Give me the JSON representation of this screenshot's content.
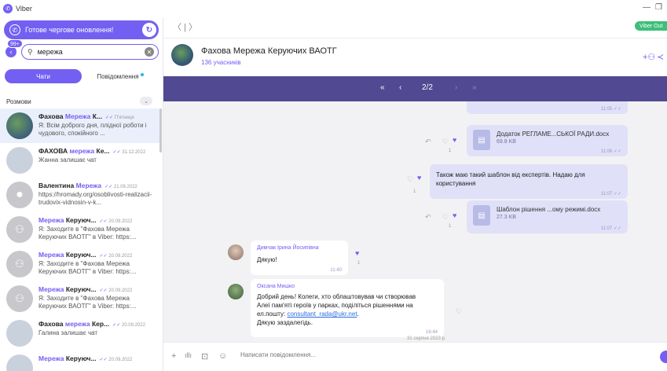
{
  "window": {
    "app_name": "Viber",
    "minimize": "—",
    "restore": "❐"
  },
  "sidebar": {
    "update_banner": "Готове чергове оновлення!",
    "notif_badge": "99+",
    "search": {
      "value": "мережа",
      "placeholder": ""
    },
    "tabs": [
      {
        "label": "Чати"
      },
      {
        "label": "Повідомлення"
      }
    ],
    "section_label": "Розмови",
    "chats": [
      {
        "pre": "Фахова ",
        "hl": "Мережа",
        "post": " К...",
        "date": "П'ятниця",
        "preview": "Я: Всім доброго дня, плідної роботи і чудового, спокійного ...",
        "avatar": "photo"
      },
      {
        "pre": "ФАХОВА ",
        "hl": "мережа",
        "post": " Ке...",
        "date": "31.12.2022",
        "preview": "Жанна залишає чат",
        "avatar": "person"
      },
      {
        "pre": "Валентина ",
        "hl": "Мережа",
        "post": "",
        "date": "21.09.2022",
        "preview": "https://hromady.org/osoblivosti-realizacii-trudovix-vidnosin-v-k...",
        "avatar": "grey"
      },
      {
        "pre": "",
        "hl": "Мережа",
        "post": " Керуюч...",
        "date": "20.09.2022",
        "preview": "Я: Заходите в \"Фахова Мережа Керуючих ВАОТГ\" в Viber: https:...",
        "avatar": "group"
      },
      {
        "pre": "",
        "hl": "Мережа",
        "post": " Керуюч...",
        "date": "20.09.2022",
        "preview": "Я: Заходите в \"Фахова Мережа Керуючих ВАОТГ\" в Viber: https:...",
        "avatar": "group"
      },
      {
        "pre": "",
        "hl": "Мережа",
        "post": " Керуюч...",
        "date": "20.09.2022",
        "preview": "Я: Заходите в \"Фахова Мережа Керуючих ВАОТГ\" в Viber: https:...",
        "avatar": "group"
      },
      {
        "pre": "Фахова ",
        "hl": "мережа",
        "post": " Кер...",
        "date": "20.09.2022",
        "preview": "Галина залишає чат",
        "avatar": "person"
      },
      {
        "pre": "",
        "hl": "Мережа",
        "post": " Керуюч...",
        "date": "20.09.2022",
        "preview": "",
        "avatar": "person"
      }
    ]
  },
  "header": {
    "viber_out": "Viber Out",
    "chat_name": "Фахова Мережа Керуючих ВАОТГ",
    "members": "136 учасників"
  },
  "search_nav": {
    "first": "«",
    "prev": "‹",
    "position": "2/2",
    "next": "›",
    "last": "»"
  },
  "messages": {
    "top_time": "11:05",
    "file1": {
      "name": "Додаток РЕГЛАМЕ...СЬКОЇ РАДИ.docx",
      "size": "69.8 KB",
      "time": "11:06",
      "reactions": "1"
    },
    "text_out": {
      "text": "Також маю такий шаблон від експертів. Надаю для користування",
      "time": "11:07",
      "reactions": "1"
    },
    "file2": {
      "name": "Шаблон рішення ...ому режимі.docx",
      "size": "27.3 KB",
      "time": "11:07",
      "reactions": "1"
    },
    "in1": {
      "sender": "Димчак Ірина Йосипівна",
      "text": "Дякую!",
      "time": "11:40",
      "reactions": "1"
    },
    "in2": {
      "sender": "Оксана Мишко",
      "line1": "Добрий день! Колеги, хто облаштовував чи створював",
      "line2": "Алеї пам'яті героїв у парках, поділіться рішеннями на",
      "line3_pre": "ел.пошту: ",
      "email": "consultant_rada@ukr.net",
      "line3_post": ".",
      "line4": "Дякую заздалегідь.",
      "time": "16:44"
    },
    "date_separator": "31 серпня 2023 р."
  },
  "composer": {
    "placeholder": "Написати повідомлення..."
  }
}
